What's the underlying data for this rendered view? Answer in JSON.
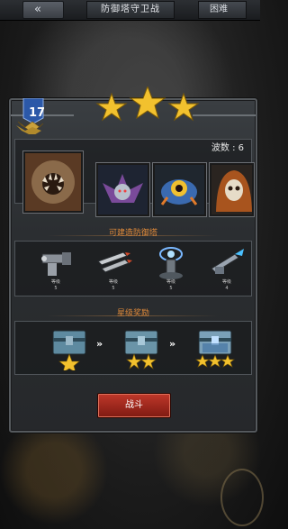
{
  "header": {
    "back_glyph": "«",
    "title": "防御塔守卫战",
    "difficulty": "困难"
  },
  "level": {
    "number": "17"
  },
  "stars": {
    "earned": 3,
    "total": 3,
    "color": "#f2c12e"
  },
  "enemies": {
    "wave_label": "波数 : 6",
    "list": [
      "boss-worm-monster",
      "purple-winged-beast",
      "blue-eye-creature",
      "hooded-skull-monk"
    ]
  },
  "towers": {
    "title": "可建造防御塔",
    "list": [
      {
        "name": "gatling-tower",
        "level_label": "等级",
        "level": "5"
      },
      {
        "name": "missile-tower",
        "level_label": "等级",
        "level": "5"
      },
      {
        "name": "tesla-tower",
        "level_label": "等级",
        "level": "5"
      },
      {
        "name": "laser-tower",
        "level_label": "等级",
        "level": "4"
      }
    ]
  },
  "rewards": {
    "title": "星级奖励",
    "arrow_glyph": "»",
    "chests": [
      {
        "stars": 1
      },
      {
        "stars": 2
      },
      {
        "stars": 3
      }
    ]
  },
  "fight_button": {
    "label": "战斗",
    "color": "#b02c20"
  }
}
